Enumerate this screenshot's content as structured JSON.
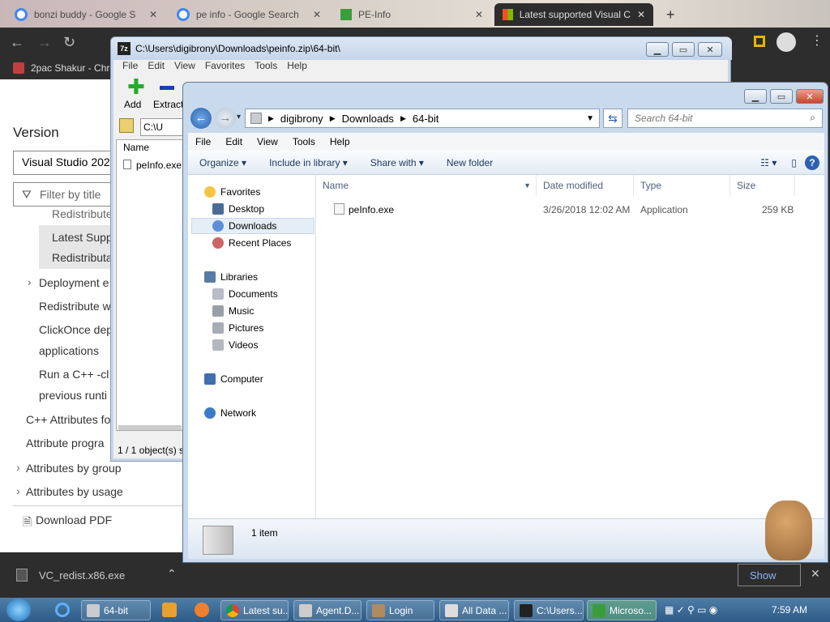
{
  "browser": {
    "tabs": [
      {
        "label": "bonzi buddy - Google S",
        "active": false
      },
      {
        "label": "pe info - Google Search",
        "active": false
      },
      {
        "label": "PE-Info",
        "active": false
      },
      {
        "label": "Latest supported Visual C",
        "active": true
      }
    ],
    "bookmark": "2pac Shakur - Chro"
  },
  "webpage": {
    "version_heading": "Version",
    "version_select": "Visual Studio 202",
    "filter_placeholder": "Filter by title",
    "nav": [
      "Redistribute",
      "Latest Supp",
      "Redistributa",
      "Deployment e",
      "Redistribute w",
      "ClickOnce dep",
      "applications",
      "Run a C++ -cl",
      "previous runti",
      "C++ Attributes fo",
      "Attribute progra",
      "Attributes by group",
      "Attributes by usage"
    ],
    "download_pdf": "Download PDF"
  },
  "downloads": {
    "file": "VC_redist.x86.exe"
  },
  "zip_window": {
    "title": "C:\\Users\\digibrony\\Downloads\\peinfo.zip\\64-bit\\",
    "menu": [
      "File",
      "Edit",
      "View",
      "Favorites",
      "Tools",
      "Help"
    ],
    "toolbar": [
      "Add",
      "Extract"
    ],
    "path_value": "C:\\U",
    "column_name": "Name",
    "file": "peInfo.exe",
    "status": "1 / 1 object(s) s"
  },
  "explorer": {
    "breadcrumb": [
      "digibrony",
      "Downloads",
      "64-bit"
    ],
    "search_placeholder": "Search 64-bit",
    "menu": [
      "File",
      "Edit",
      "View",
      "Tools",
      "Help"
    ],
    "commands": [
      "Organize",
      "Include in library",
      "Share with",
      "New folder"
    ],
    "nav": {
      "favorites": "Favorites",
      "desktop": "Desktop",
      "downloads": "Downloads",
      "recent": "Recent Places",
      "libraries": "Libraries",
      "documents": "Documents",
      "music": "Music",
      "pictures": "Pictures",
      "videos": "Videos",
      "computer": "Computer",
      "network": "Network"
    },
    "columns": [
      "Name",
      "Date modified",
      "Type",
      "Size"
    ],
    "files": [
      {
        "name": "peInfo.exe",
        "date": "3/26/2018 12:02 AM",
        "type": "Application",
        "size": "259 KB"
      }
    ],
    "status": "1 item"
  },
  "taskbar": {
    "items": [
      "64-bit",
      "Latest su...",
      "Agent.D...",
      "Login",
      "All Data ...",
      "C:\\Users...",
      "Microso..."
    ],
    "clock": "7:59 AM",
    "show_button": "Show"
  },
  "colors": {
    "accent": "#3a6ea5",
    "chrome_dark": "#2d2d2d",
    "selection": "#cce8ff"
  }
}
